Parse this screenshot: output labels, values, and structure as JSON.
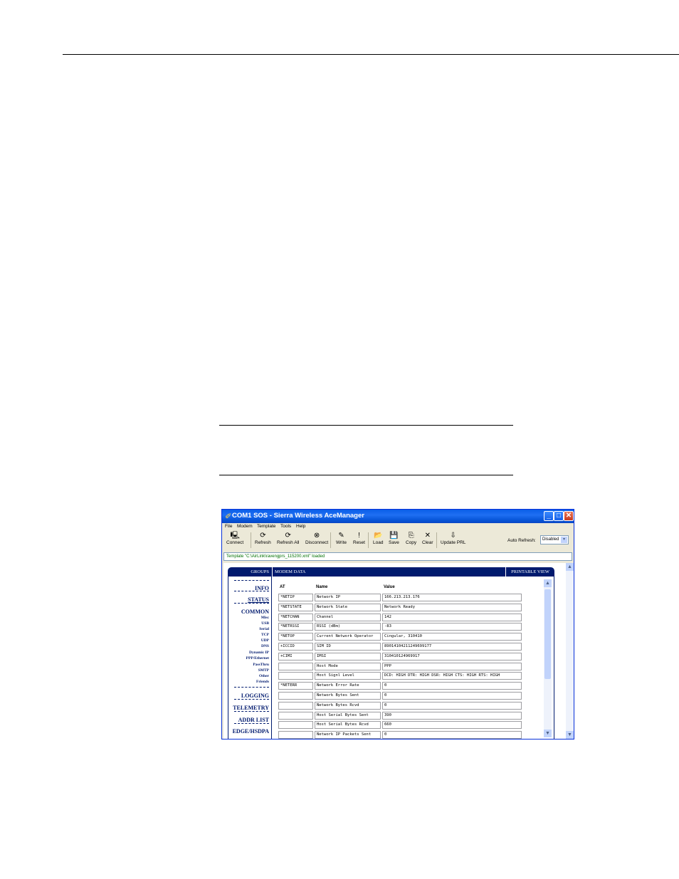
{
  "window": {
    "title": "COM1 SOS - Sierra Wireless AceManager",
    "menu": [
      "File",
      "Modem",
      "Template",
      "Tools",
      "Help"
    ],
    "toolbar": [
      {
        "label": "Connect",
        "icon": "connect-icon",
        "glyph": "🖳"
      },
      {
        "label": "Refresh",
        "icon": "refresh-icon",
        "glyph": "⟳"
      },
      {
        "label": "Refresh All",
        "icon": "refresh-all-icon",
        "glyph": "⟳"
      },
      {
        "label": "Disconnect",
        "icon": "disconnect-icon",
        "glyph": "⊗"
      },
      {
        "label": "Write",
        "icon": "write-icon",
        "glyph": "✎"
      },
      {
        "label": "Reset",
        "icon": "reset-icon",
        "glyph": "!"
      },
      {
        "label": "Load",
        "icon": "load-icon",
        "glyph": "📂"
      },
      {
        "label": "Save",
        "icon": "save-icon",
        "glyph": "💾"
      },
      {
        "label": "Copy",
        "icon": "copy-icon",
        "glyph": "⎘"
      },
      {
        "label": "Clear",
        "icon": "clear-icon",
        "glyph": "✕"
      },
      {
        "label": "Update PRL",
        "icon": "update-prl-icon",
        "glyph": "⇩"
      }
    ],
    "auto_refresh_label": "Auto Refresh:",
    "auto_refresh_value": "Disabled",
    "status_message": "Template \"C:\\AirLink\\ravengprs_115200.xml\" loaded"
  },
  "panel": {
    "groups_header": "GROUPS",
    "modem_header": "MODEM DATA",
    "printable_header": "PRINTABLE VIEW",
    "groups": [
      {
        "label": "INFO",
        "type": "main"
      },
      {
        "label": "STATUS",
        "type": "main"
      },
      {
        "label": "COMMON",
        "type": "main"
      },
      {
        "label": "Misc",
        "type": "sub"
      },
      {
        "label": "USB",
        "type": "sub"
      },
      {
        "label": "Serial",
        "type": "sub"
      },
      {
        "label": "TCP",
        "type": "sub"
      },
      {
        "label": "UDP",
        "type": "sub"
      },
      {
        "label": "DNS",
        "type": "sub"
      },
      {
        "label": "Dynamic IP",
        "type": "sub"
      },
      {
        "label": "PPP/Ethernet",
        "type": "sub"
      },
      {
        "label": "PassThru",
        "type": "sub"
      },
      {
        "label": "SMTP",
        "type": "sub"
      },
      {
        "label": "Other",
        "type": "sub"
      },
      {
        "label": "Friends",
        "type": "sub"
      },
      {
        "label": "LOGGING",
        "type": "main"
      },
      {
        "label": "TELEMETRY",
        "type": "main"
      },
      {
        "label": "ADDR LIST",
        "type": "main"
      },
      {
        "label": "EDGE/HSDPA",
        "type": "main"
      }
    ],
    "columns": {
      "at": "AT",
      "name": "Name",
      "value": "Value"
    },
    "rows": [
      {
        "at": "*NETIP",
        "name": "Network IP",
        "value": "166.213.213.176"
      },
      {
        "at": "*NETSTATE",
        "name": "Network State",
        "value": "Network Ready"
      },
      {
        "at": "*NETCHAN",
        "name": "Channel",
        "value": "142"
      },
      {
        "at": "*NETRSSI",
        "name": "RSSI (dBm)",
        "value": "-83"
      },
      {
        "at": "*NETOP",
        "name": "Current Network Operator",
        "value": "Cingular, 310410"
      },
      {
        "at": "+ICCID",
        "name": "SIM ID",
        "value": "89014104211249699177"
      },
      {
        "at": "+CIMI",
        "name": "IMSI",
        "value": "310410124969917"
      },
      {
        "at": "",
        "name": "Host Mode",
        "value": "PPP"
      },
      {
        "at": "",
        "name": "Host Signl Level",
        "value": "DCD: HIGH DTR: HIGH DSR: HIGH CTS: HIGH RTS: HIGH"
      },
      {
        "at": "*NETERR",
        "name": "Network Error Rate",
        "value": "0"
      },
      {
        "at": "",
        "name": "Network Bytes Sent",
        "value": "0"
      },
      {
        "at": "",
        "name": "Network Bytes Rcvd",
        "value": "0"
      },
      {
        "at": "",
        "name": "Host Serial Bytes Sent",
        "value": "390"
      },
      {
        "at": "",
        "name": "Host Serial Bytes Rcvd",
        "value": "660"
      },
      {
        "at": "",
        "name": "Network IP Packets Sent",
        "value": "0"
      }
    ]
  }
}
